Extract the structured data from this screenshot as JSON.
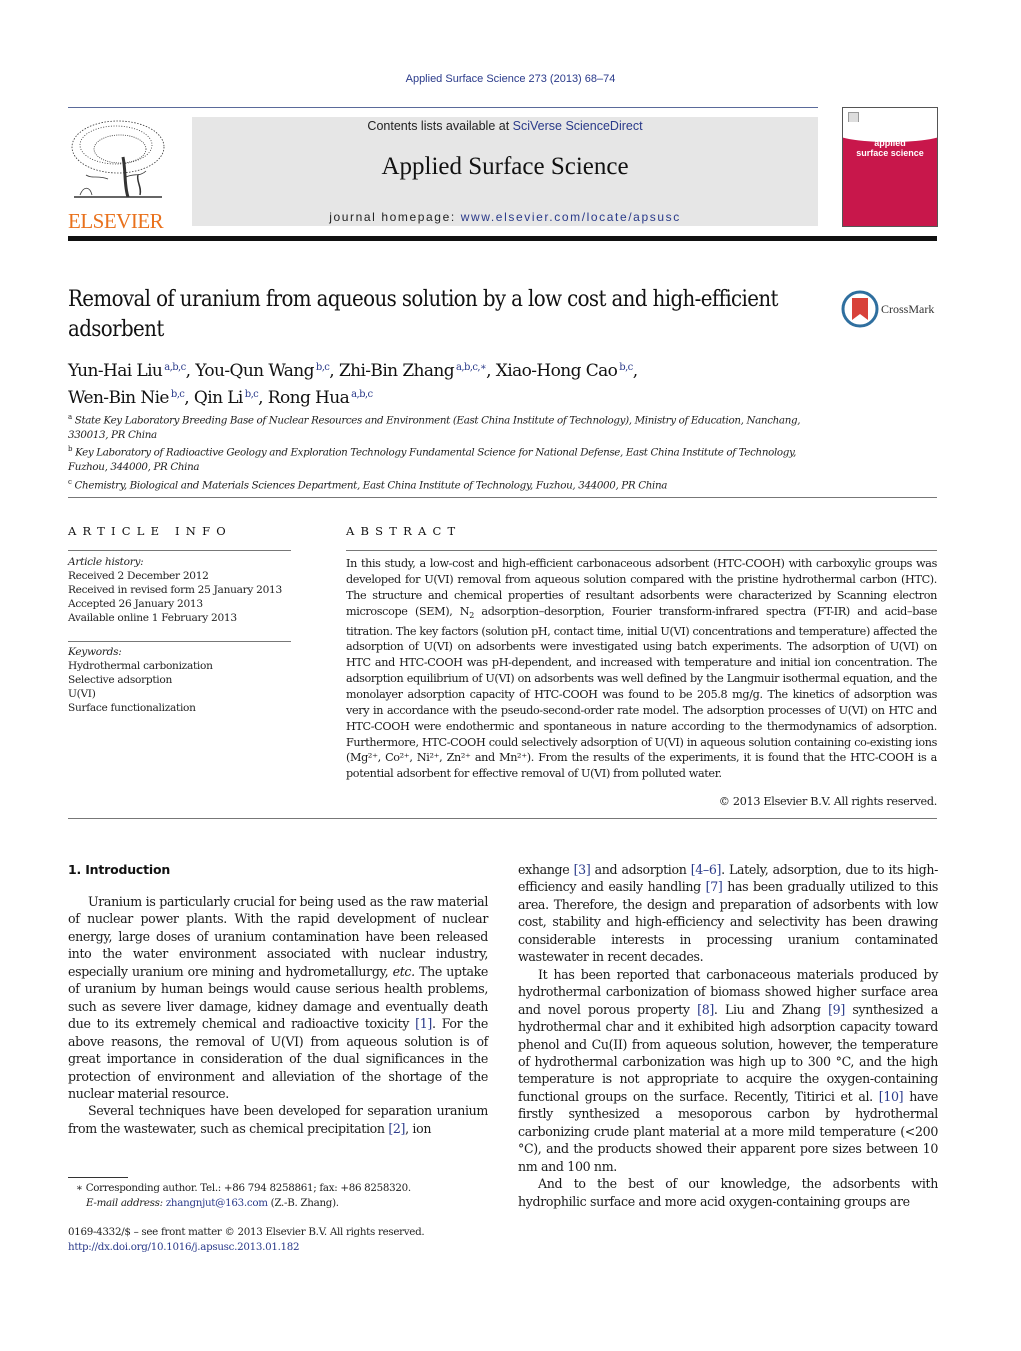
{
  "header": {
    "citation": "Applied Surface Science 273 (2013) 68–74",
    "publisher_logo_text": "ELSEVIER",
    "contents_prefix": "Contents lists available at ",
    "contents_link": "SciVerse ScienceDirect",
    "journal_name": "Applied Surface Science",
    "homepage_prefix": "journal homepage: ",
    "homepage_link": "www.elsevier.com/locate/apsusc",
    "cover_title_line1": "applied",
    "cover_title_line2": "surface science",
    "cover_color": "#c8174b",
    "crossmark_label": "CrossMark"
  },
  "article": {
    "title": "Removal of uranium from aqueous solution by a low cost and high-efficient adsorbent",
    "authors": [
      {
        "name": "Yun-Hai Liu",
        "affil": "a,b,c"
      },
      {
        "name": "You-Qun Wang",
        "affil": "b,c"
      },
      {
        "name": "Zhi-Bin Zhang",
        "affil": "a,b,c,∗"
      },
      {
        "name": "Xiao-Hong Cao",
        "affil": "b,c"
      },
      {
        "name": "Wen-Bin Nie",
        "affil": "b,c"
      },
      {
        "name": "Qin Li",
        "affil": "b,c"
      },
      {
        "name": "Rong Hua",
        "affil": "a,b,c"
      }
    ],
    "affiliations": [
      {
        "mark": "a",
        "text": "State Key Laboratory Breeding Base of Nuclear Resources and Environment (East China Institute of Technology), Ministry of Education, Nanchang, 330013, PR China"
      },
      {
        "mark": "b",
        "text": "Key Laboratory of Radioactive Geology and Exploration Technology Fundamental Science for National Defense, East China Institute of Technology, Fuzhou, 344000, PR China"
      },
      {
        "mark": "c",
        "text": "Chemistry, Biological and Materials Sciences Department, East China Institute of Technology, Fuzhou, 344000, PR China"
      }
    ]
  },
  "article_info": {
    "heading": "ARTICLE INFO",
    "history_label": "Article history:",
    "history": [
      "Received 2 December 2012",
      "Received in revised form 25 January 2013",
      "Accepted 26 January 2013",
      "Available online 1 February 2013"
    ],
    "keywords_label": "Keywords:",
    "keywords": [
      "Hydrothermal carbonization",
      "Selective adsorption",
      "U(VI)",
      "Surface functionalization"
    ]
  },
  "abstract": {
    "heading": "ABSTRACT",
    "text_part1": "In this study, a low-cost and high-efficient carbonaceous adsorbent (HTC-COOH) with carboxylic groups was developed for U(VI) removal from aqueous solution compared with the pristine hydrothermal carbon (HTC). The structure and chemical properties of resultant adsorbents were characterized by Scanning electron microscope (SEM), N",
    "text_sub": "2",
    "text_part2": " adsorption–desorption, Fourier transform-infrared spectra (FT-IR) and acid–base titration. The key factors (solution pH, contact time, initial U(VI) concentrations and temperature) affected the adsorption of U(VI) on adsorbents were investigated using batch experiments. The adsorption of U(VI) on HTC and HTC-COOH was pH-dependent, and increased with temperature and initial ion concentration. The adsorption equilibrium of U(VI) on adsorbents was well defined by the Langmuir isothermal equation, and the monolayer adsorption capacity of HTC-COOH was found to be 205.8 mg/g. The kinetics of adsorption was very in accordance with the pseudo-second-order rate model. The adsorption processes of U(VI) on HTC and HTC-COOH were endothermic and spontaneous in nature according to the thermodynamics of adsorption. Furthermore, HTC-COOH could selectively adsorption of U(VI) in aqueous solution containing co-existing ions (Mg²⁺, Co²⁺, Ni²⁺, Zn²⁺ and Mn²⁺). From the results of the experiments, it is found that the HTC-COOH is a potential adsorbent for effective removal of U(VI) from polluted water.",
    "copyright": "© 2013 Elsevier B.V. All rights reserved."
  },
  "body": {
    "section_title": "1.  Introduction",
    "col1": {
      "p1_a": "Uranium is particularly crucial for being used as the raw material of nuclear power plants. With the rapid development of nuclear energy, large doses of uranium contamination have been released into the water environment associated with nuclear industry, especially uranium ore mining and hydrometallurgy, ",
      "p1_etc": "etc.",
      "p1_b": " The uptake of uranium by human beings would cause serious health problems, such as severe liver damage, kidney damage and eventually death due to its extremely chemical and radioactive toxicity ",
      "ref1": "[1]",
      "p1_c": ". For the above reasons, the removal of U(VI) from aqueous solution is of great importance in consideration of the dual significances in the protection of environment and alleviation of the shortage of the nuclear material resource.",
      "p2_a": "Several techniques have been developed for separation uranium from the wastewater, such as chemical precipitation ",
      "ref2": "[2]",
      "p2_b": ", ion"
    },
    "col2": {
      "p1_a": "exhange ",
      "ref3": "[3]",
      "p1_b": " and adsorption ",
      "ref4_6": "[4–6]",
      "p1_c": ". Lately, adsorption, due to its high-efficiency and easily handling ",
      "ref7": "[7]",
      "p1_d": " has been gradually utilized to this area. Therefore, the design and preparation of adsorbents with low cost, stability and high-efficiency and selectivity has been drawing considerable interests in processing uranium contaminated wastewater in recent decades.",
      "p2_a": "It has been reported that carbonaceous materials produced by hydrothermal carbonization of biomass showed higher surface area and novel porous property ",
      "ref8": "[8]",
      "p2_b": ". Liu and Zhang ",
      "ref9": "[9]",
      "p2_c": " synthesized a hydrothermal char and it exhibited high adsorption capacity toward phenol and Cu(II) from aqueous solution, however, the temperature of hydrothermal carbonization was high up to 300 °C, and the high temperature is not appropriate to acquire the oxygen-containing functional groups on the surface. Recently, Titirici et al. ",
      "ref10": "[10]",
      "p2_d": " have firstly synthesized a mesoporous carbon by hydrothermal carbonizing crude plant material at a more mild temperature (<200 °C), and the products showed their apparent pore sizes between 10 nm and 100 nm.",
      "p3": "And to the best of our knowledge, the adsorbents with hydrophilic surface and more acid oxygen-containing groups are"
    }
  },
  "footnotes": {
    "star": "∗",
    "corresponding": "Corresponding author. Tel.: +86 794 8258861; fax: +86 8258320.",
    "email_label": "E-mail address: ",
    "email": "zhangnjut@163.com",
    "email_suffix": " (Z.-B. Zhang).",
    "issn": "0169-4332/$ – see front matter © 2013 Elsevier B.V. All rights reserved.",
    "doi": "http://dx.doi.org/10.1016/j.apsusc.2013.01.182"
  }
}
